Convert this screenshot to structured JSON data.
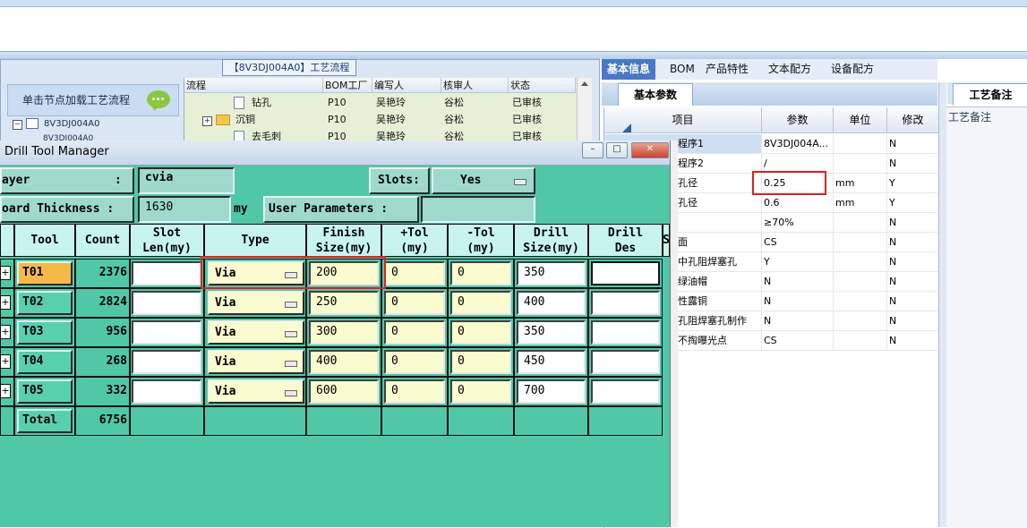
{
  "colors": {
    "teal_bg": "#50c8a8",
    "highlight_red": "#e02020",
    "tool_active": "#f5b94a"
  },
  "process_panel": {
    "title": "【8V3DJ004A0】工艺流程",
    "load_button": "单击节点加载工艺流程",
    "tree_node": "8V3DJ004A0",
    "tree_node_partial": "8V3DJ004A0",
    "grid_headers": [
      "流程",
      "BOM工厂",
      "编写人",
      "核审人",
      "状态"
    ],
    "grid_rows": [
      {
        "step": "钻孔",
        "plant": "P10",
        "writer": "吴艳玲",
        "reviewer": "谷松",
        "status": "已审核"
      },
      {
        "step": "沉铜",
        "plant": "P10",
        "writer": "吴艳玲",
        "reviewer": "谷松",
        "status": "已审核"
      },
      {
        "step": "去毛刺",
        "plant": "P10",
        "writer": "吴艳玲",
        "reviewer": "谷松",
        "status": "已审核"
      }
    ]
  },
  "right_panel": {
    "tabs": [
      "基本信息",
      "BOM",
      "产品特性",
      "文本配方",
      "设备配方"
    ],
    "subtab": "基本参数",
    "headers": [
      "项目",
      "参数",
      "单位",
      "修改"
    ],
    "rows": [
      {
        "item": "程序1",
        "value": "8V3DJ004A...",
        "unit": "",
        "edit": "N"
      },
      {
        "item": "程序2",
        "value": "/",
        "unit": "",
        "edit": "N"
      },
      {
        "item": "孔径",
        "value": "0.25",
        "unit": "mm",
        "edit": "Y"
      },
      {
        "item": "孔径",
        "value": "0.6",
        "unit": "mm",
        "edit": "Y"
      },
      {
        "item": "",
        "value": "≥70%",
        "unit": "",
        "edit": "N"
      },
      {
        "item": "面",
        "value": "CS",
        "unit": "",
        "edit": "N"
      },
      {
        "item": "中孔阻焊塞孔",
        "value": "Y",
        "unit": "",
        "edit": "N"
      },
      {
        "item": "绿油帽",
        "value": "N",
        "unit": "",
        "edit": "N"
      },
      {
        "item": "性露铜",
        "value": "N",
        "unit": "",
        "edit": "N"
      },
      {
        "item": "孔阻焊塞孔制作",
        "value": "N",
        "unit": "",
        "edit": "N"
      },
      {
        "item": "不掏曝光点",
        "value": "CS",
        "unit": "",
        "edit": "N"
      }
    ],
    "side_tab": "工艺备注",
    "side_label": "工艺备注"
  },
  "drill": {
    "window_title": "Drill Tool Manager",
    "layer_label": "ayer",
    "layer_colon": ":",
    "layer_value": "cvia",
    "slots_label": "Slots:",
    "slots_value": "Yes",
    "thickness_label": "oard Thickness :",
    "thickness_value": "1630",
    "thickness_unit": "my",
    "user_params_label": "User Parameters :",
    "user_params_value": "",
    "headers": {
      "tool": "Tool",
      "count": "Count",
      "slot": "Slot\nLen(my)",
      "type": "Type",
      "finish": "Finish\nSize(my)",
      "ptol": "+Tol\n(my)",
      "ntol": "-Tol\n(my)",
      "drill": "Drill\nSize(my)",
      "des": "Drill\nDes",
      "extra": "S"
    },
    "tools": [
      {
        "tool": "T01",
        "count": "2376",
        "slot": "",
        "type": "Via",
        "finish": "200",
        "ptol": "0",
        "ntol": "0",
        "drill": "350",
        "des": ""
      },
      {
        "tool": "T02",
        "count": "2824",
        "slot": "",
        "type": "Via",
        "finish": "250",
        "ptol": "0",
        "ntol": "0",
        "drill": "400",
        "des": ""
      },
      {
        "tool": "T03",
        "count": "956",
        "slot": "",
        "type": "Via",
        "finish": "300",
        "ptol": "0",
        "ntol": "0",
        "drill": "350",
        "des": ""
      },
      {
        "tool": "T04",
        "count": "268",
        "slot": "",
        "type": "Via",
        "finish": "400",
        "ptol": "0",
        "ntol": "0",
        "drill": "450",
        "des": ""
      },
      {
        "tool": "T05",
        "count": "332",
        "slot": "",
        "type": "Via",
        "finish": "600",
        "ptol": "0",
        "ntol": "0",
        "drill": "700",
        "des": ""
      }
    ],
    "total_label": "Total",
    "total_count": "6756"
  }
}
